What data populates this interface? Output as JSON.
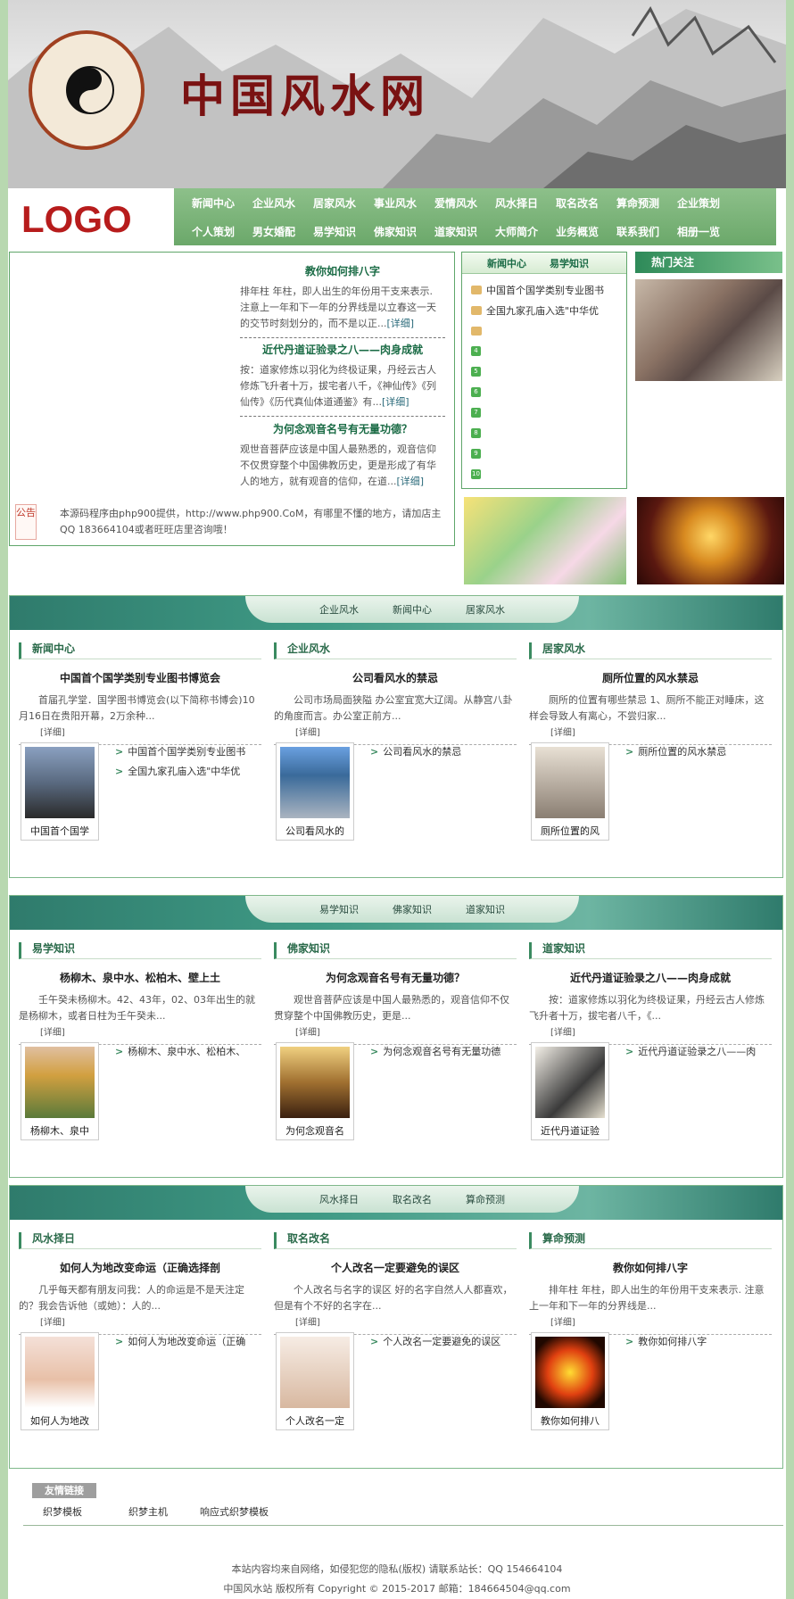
{
  "banner": {
    "title": "中国风水网"
  },
  "logo": "LOGO",
  "nav": {
    "row1": [
      "新闻中心",
      "企业风水",
      "居家风水",
      "事业风水",
      "爱情风水",
      "风水择日",
      "取名改名",
      "算命预测",
      "企业策划"
    ],
    "row2": [
      "个人策划",
      "男女婚配",
      "易学知识",
      "佛家知识",
      "道家知识",
      "大师简介",
      "业务概览",
      "联系我们",
      "相册一览"
    ]
  },
  "top_articles": [
    {
      "title": "教你如何排八字",
      "summary": "排年柱 年柱，即人出生的年份用干支来表示. 注意上一年和下一年的分界线是以立春这一天的交节时刻划分的，而不是以正...",
      "more": "[详细]"
    },
    {
      "title": "近代丹道证验录之八——肉身成就",
      "summary": "按：道家修炼以羽化为终极证果，丹经云古人修炼飞升者十万，拔宅者八千，《神仙传》《列仙传》《历代真仙体道通鉴》有...",
      "more": "[详细]"
    },
    {
      "title": "为何念观音名号有无量功德？",
      "summary": "观世音菩萨应该是中国人最熟悉的，观音信仰不仅贯穿整个中国佛教历史，更是形成了有华人的地方，就有观音的信仰，在道...",
      "more": "[详细]"
    }
  ],
  "notice": {
    "label": "公告",
    "text": "本源码程序由php900提供，http://www.php900.CoM，有哪里不懂的地方，请加店主QQ 183664104或者旺旺店里咨询哦！"
  },
  "midbox": {
    "tabs": [
      "新闻中心",
      "易学知识"
    ],
    "items": [
      "中国首个国学类别专业图书",
      "全国九家孔庙入选\"中华优",
      "",
      "4",
      "5",
      "6",
      "7",
      "8",
      "9",
      "10"
    ]
  },
  "hot": {
    "title": "热门关注"
  },
  "sections": [
    {
      "tabs": [
        "企业风水",
        "新闻中心",
        "居家风水"
      ],
      "cols": [
        {
          "heading": "新闻中心",
          "title": "中国首个国学类别专业图书博览会",
          "summary": "首届孔学堂．国学图书博览会(以下简称书博会)10月16日在贵阳开幕，2万余种...",
          "more": "[详细]",
          "thumb": "中国首个国学",
          "list": [
            "中国首个国学类别专业图书",
            "全国九家孔庙入选\"中华优"
          ]
        },
        {
          "heading": "企业风水",
          "title": "公司看风水的禁忌",
          "summary": "公司市场局面狭隘 办公室宜宽大辽阔。从静宫八卦的角度而言。办公室正前方...",
          "more": "[详细]",
          "thumb": "公司看风水的",
          "list": [
            "公司看风水的禁忌"
          ]
        },
        {
          "heading": "居家风水",
          "title": "厕所位置的风水禁忌",
          "summary": "厕所的位置有哪些禁忌 1、厕所不能正对睡床，这样会导致人有离心，不尝归家...",
          "more": "[详细]",
          "thumb": "厕所位置的风",
          "list": [
            "厕所位置的风水禁忌"
          ]
        }
      ]
    },
    {
      "tabs": [
        "易学知识",
        "佛家知识",
        "道家知识"
      ],
      "cols": [
        {
          "heading": "易学知识",
          "title": "杨柳木、泉中水、松柏木、壁上土",
          "summary": "壬午癸未杨柳木。42、43年，02、03年出生的就是杨柳木，或者日柱为壬午癸未...",
          "more": "[详细]",
          "thumb": "杨柳木、泉中",
          "list": [
            "杨柳木、泉中水、松柏木、"
          ]
        },
        {
          "heading": "佛家知识",
          "title": "为何念观音名号有无量功德？",
          "summary": "观世音菩萨应该是中国人最熟悉的，观音信仰不仅贯穿整个中国佛教历史，更是...",
          "more": "[详细]",
          "thumb": "为何念观音名",
          "list": [
            "为何念观音名号有无量功德"
          ]
        },
        {
          "heading": "道家知识",
          "title": "近代丹道证验录之八——肉身成就",
          "summary": "按：道家修炼以羽化为终极证果，丹经云古人修炼飞升者十万，拔宅者八千，《...",
          "more": "[详细]",
          "thumb": "近代丹道证验",
          "list": [
            "近代丹道证验录之八——肉"
          ]
        }
      ]
    },
    {
      "tabs": [
        "风水择日",
        "取名改名",
        "算命预测"
      ],
      "cols": [
        {
          "heading": "风水择日",
          "title": "如何人为地改变命运（正确选择剖",
          "summary": "几乎每天都有朋友问我：人的命运是不是天注定的？我会告诉他（或她）：人的...",
          "more": "[详细]",
          "thumb": "如何人为地改",
          "list": [
            "如何人为地改变命运（正确"
          ]
        },
        {
          "heading": "取名改名",
          "title": "个人改名一定要避免的误区",
          "summary": "个人改名与名字的误区 好的名字自然人人都喜欢，但是有个不好的名字在...",
          "more": "[详细]",
          "thumb": "个人改名一定",
          "list": [
            "个人改名一定要避免的误区"
          ]
        },
        {
          "heading": "算命预测",
          "title": "教你如何排八字",
          "summary": "排年柱 年柱，即人出生的年份用干支来表示. 注意上一年和下一年的分界线是...",
          "more": "[详细]",
          "thumb": "教你如何排八",
          "list": [
            "教你如何排八字"
          ]
        }
      ]
    }
  ],
  "links": {
    "title": "友情链接",
    "items": [
      "织梦模板",
      "织梦主机",
      "响应式织梦模板"
    ]
  },
  "footer": {
    "line1": "本站内容均来自网络，如侵犯您的隐私(版权) 请联系站长：QQ 154664104",
    "line2": "中国风水站 版权所有 Copyright © 2015-2017 邮箱：184664504@qq.com"
  }
}
